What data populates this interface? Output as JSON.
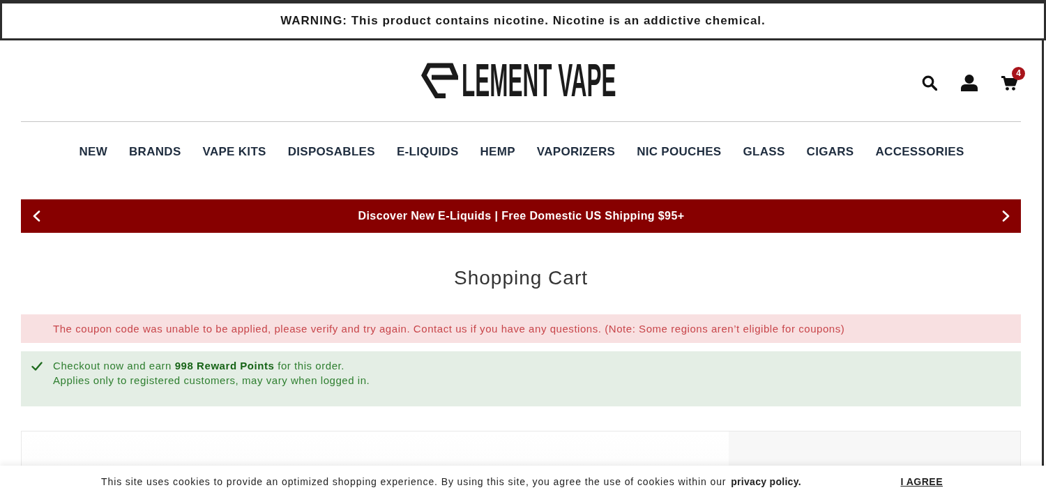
{
  "warning_banner": {
    "text": "WARNING: This product contains nicotine. Nicotine is an addictive chemical."
  },
  "header": {
    "logo": {
      "text": "LEMENT VAPE"
    },
    "cart_count": "4"
  },
  "nav": {
    "items": [
      "NEW",
      "BRANDS",
      "VAPE KITS",
      "DISPOSABLES",
      "E-LIQUIDS",
      "HEMP",
      "VAPORIZERS",
      "NIC POUCHES",
      "GLASS",
      "CIGARS",
      "ACCESSORIES"
    ]
  },
  "promo_bar": {
    "text": "Discover New E-Liquids | Free Domestic US Shipping $95+"
  },
  "page_title": "Shopping Cart",
  "alerts": [
    {
      "kind": "error",
      "lines": [
        "The coupon code was unable to be applied, please verify and try again. Contact us if you have any questions. (Note: Some regions aren’t eligible for coupons)"
      ]
    },
    {
      "kind": "success",
      "lines": [
        "Checkout now and earn **998 Reward Points** for this order.",
        "Applies only to registered customers, may vary when logged in."
      ]
    }
  ],
  "cookie_banner": {
    "text": "This site uses cookies to provide an optimized shopping experience. By using this site, you agree the use of cookies within our",
    "link": "privacy policy.",
    "button": "I AGREE"
  }
}
